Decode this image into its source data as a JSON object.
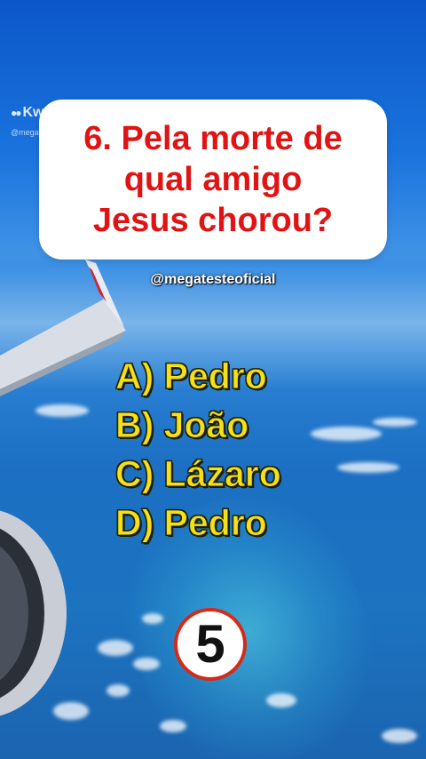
{
  "watermark": {
    "logo_text": "Kwai",
    "handle": "@megatesteoficial"
  },
  "question": {
    "text": "6. Pela morte de\nqual amigo\nJesus chorou?"
  },
  "channel_handle": "@megatesteoficial",
  "options": [
    {
      "label": "A) Pedro"
    },
    {
      "label": "B) João"
    },
    {
      "label": "C) Lázaro"
    },
    {
      "label": "D) Pedro"
    }
  ],
  "timer": {
    "value": "5"
  },
  "colors": {
    "question_text": "#e01414",
    "option_text": "#f4e01c",
    "timer_ring": "#d42a1a",
    "card_bg": "#ffffff"
  }
}
